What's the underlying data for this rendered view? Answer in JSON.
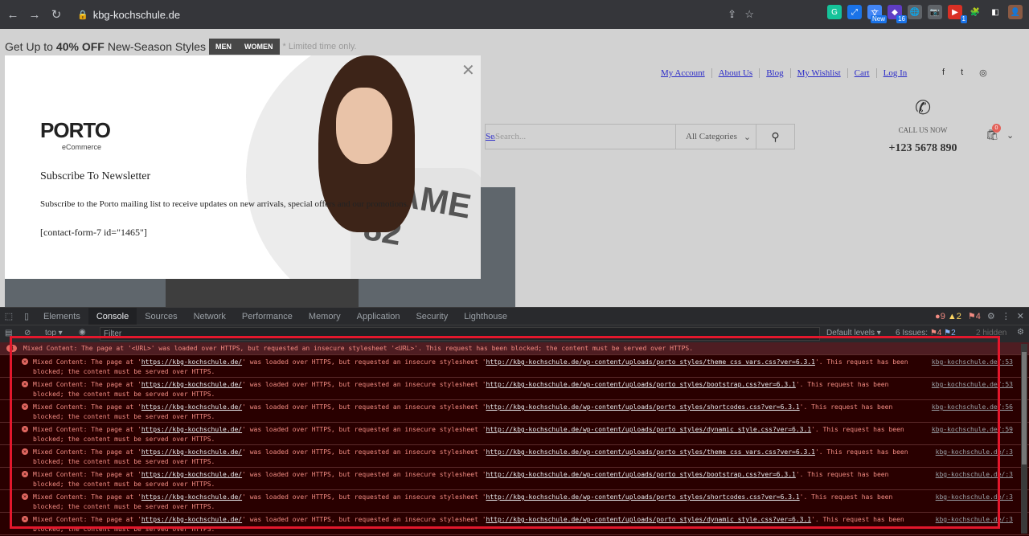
{
  "browser": {
    "url": "kbg-kochschule.de",
    "extensions": [
      {
        "icon": "grammarly-icon",
        "color": "#15c39a",
        "glyph": "G"
      },
      {
        "icon": "expand-icon",
        "color": "#1a73e8",
        "glyph": "⤢"
      },
      {
        "icon": "translate-icon",
        "color": "#4285f4",
        "glyph": "文",
        "badge": "New"
      },
      {
        "icon": "extension-badge-icon",
        "color": "#5f3dc4",
        "glyph": "◆",
        "badge": "16"
      },
      {
        "icon": "globe-icon",
        "color": "#5f6368",
        "glyph": "🌐"
      },
      {
        "icon": "camera-icon",
        "color": "#5f6368",
        "glyph": "📷"
      },
      {
        "icon": "extension-red-icon",
        "color": "#d93025",
        "glyph": "▶",
        "badge": "1"
      },
      {
        "icon": "puzzle-icon",
        "color": "#35363a",
        "glyph": "🧩"
      },
      {
        "icon": "sidepanel-icon",
        "color": "#35363a",
        "glyph": "◧"
      },
      {
        "icon": "profile-avatar",
        "color": "#8a5a44",
        "glyph": "👤"
      }
    ]
  },
  "page": {
    "promo": {
      "prefix": "Get Up to",
      "bold": "40% OFF",
      "suffix": "New-Season Styles",
      "tag_men": "MEN",
      "tag_women": "WOMEN",
      "limited": "* Limited time only."
    },
    "top_links": [
      "My Account",
      "About Us",
      "Blog",
      "My Wishlist",
      "Cart",
      "Log In"
    ],
    "social": [
      "f",
      "t",
      "◎"
    ],
    "search": {
      "label": "Search",
      "placeholder": "Search...",
      "category": "All Categories"
    },
    "call": {
      "label": "CALL US NOW",
      "number": "+123 5678 890"
    },
    "cart_count": "0",
    "popup": {
      "logo_main": "PORTO",
      "logo_sub": "eCommerce",
      "heading": "Subscribe To Newsletter",
      "text": "Subscribe to the Porto mailing list to receive updates on new arrivals, special offers and our promotions.",
      "shortcode": "[contact-form-7 id=\"1465\"]",
      "shirt_text": "GAME 82"
    }
  },
  "devtools": {
    "tabs": [
      "Elements",
      "Console",
      "Sources",
      "Network",
      "Performance",
      "Memory",
      "Application",
      "Security",
      "Lighthouse"
    ],
    "active_tab": "Console",
    "errors": "9",
    "warnings": "2",
    "issues_badge": "4",
    "context": "top",
    "filter_placeholder": "Filter",
    "levels": "Default levels",
    "issues": "6 Issues:",
    "issues_errors": "4",
    "issues_info": "2",
    "hidden": "2 hidden",
    "group": {
      "count": "8",
      "text": "Mixed Content: The page at '<URL>' was loaded over HTTPS, but requested an insecure stylesheet '<URL>'. This request has been blocked; the content must be served over HTTPS."
    },
    "messages": [
      {
        "page": "https://kbg-kochschule.de/",
        "res": "http://kbg-kochschule.de/wp-content/uploads/porto_styles/theme_css_vars.css?ver=6.3.1",
        "src": "kbg-kochschule.de/:53"
      },
      {
        "page": "https://kbg-kochschule.de/",
        "res": "http://kbg-kochschule.de/wp-content/uploads/porto_styles/bootstrap.css?ver=6.3.1",
        "src": "kbg-kochschule.de/:53"
      },
      {
        "page": "https://kbg-kochschule.de/",
        "res": "http://kbg-kochschule.de/wp-content/uploads/porto_styles/shortcodes.css?ver=6.3.1",
        "src": "kbg-kochschule.de/:56"
      },
      {
        "page": "https://kbg-kochschule.de/",
        "res": "http://kbg-kochschule.de/wp-content/uploads/porto_styles/dynamic_style.css?ver=6.3.1",
        "src": "kbg-kochschule.de/:59"
      },
      {
        "page": "https://kbg-kochschule.de/",
        "res": "http://kbg-kochschule.de/wp-content/uploads/porto_styles/theme_css_vars.css?ver=6.3.1",
        "src": "kbg-kochschule.de/:3"
      },
      {
        "page": "https://kbg-kochschule.de/",
        "res": "http://kbg-kochschule.de/wp-content/uploads/porto_styles/bootstrap.css?ver=6.3.1",
        "src": "kbg-kochschule.de/:3"
      },
      {
        "page": "https://kbg-kochschule.de/",
        "res": "http://kbg-kochschule.de/wp-content/uploads/porto_styles/shortcodes.css?ver=6.3.1",
        "src": "kbg-kochschule.de/:3"
      },
      {
        "page": "https://kbg-kochschule.de/",
        "res": "http://kbg-kochschule.de/wp-content/uploads/porto_styles/dynamic_style.css?ver=6.3.1",
        "src": "kbg-kochschule.de/:3"
      }
    ],
    "msg_prefix": "Mixed Content: The page at '",
    "msg_mid": "' was loaded over HTTPS, but requested an insecure stylesheet '",
    "msg_end": "'. This request has been blocked; the content must be served over HTTPS."
  }
}
